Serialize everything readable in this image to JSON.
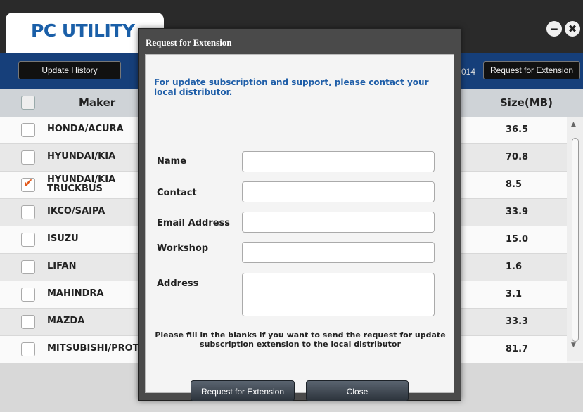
{
  "app": {
    "title": "PC UTILITY",
    "minimize_symbol": "−",
    "close_symbol": "✖"
  },
  "toolbar": {
    "update_history": "Update History",
    "date_fragment": "014",
    "request_extension": "Request for Extension"
  },
  "table": {
    "header_maker": "Maker",
    "header_size": "Size(MB)",
    "rows": [
      {
        "maker": "HONDA/ACURA",
        "size": "36.5",
        "checked": false
      },
      {
        "maker": "HYUNDAI/KIA",
        "size": "70.8",
        "checked": false
      },
      {
        "maker": "HYUNDAI/KIA\nTRUCKBUS",
        "size": "8.5",
        "checked": true
      },
      {
        "maker": "IKCO/SAIPA",
        "size": "33.9",
        "checked": false
      },
      {
        "maker": "ISUZU",
        "size": "15.0",
        "checked": false
      },
      {
        "maker": "LIFAN",
        "size": "1.6",
        "checked": false
      },
      {
        "maker": "MAHINDRA",
        "size": "3.1",
        "checked": false
      },
      {
        "maker": "MAZDA",
        "size": "33.3",
        "checked": false
      },
      {
        "maker": "MITSUBISHI/PROT",
        "size": "81.7",
        "checked": false
      }
    ]
  },
  "dialog": {
    "title": "Request for Extension",
    "info": "For update subscription and support, please contact your local distributor.",
    "fields": {
      "name_label": "Name",
      "contact_label": "Contact",
      "email_label": "Email Address",
      "workshop_label": "Workshop",
      "address_label": "Address"
    },
    "note": "Please fill in the blanks if you want to send the request for update subscription extension to the local distributor",
    "request_button": "Request for Extension",
    "close_button": "Close"
  },
  "colors": {
    "title_blue": "#1a5fa8",
    "toolbar_blue": "#163f7a",
    "check_orange": "#e25a1c"
  }
}
